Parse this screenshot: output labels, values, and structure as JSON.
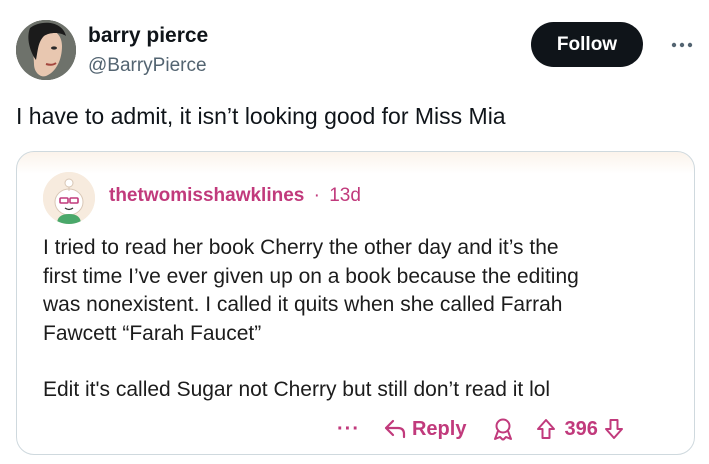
{
  "tweet": {
    "author": {
      "display_name": "barry pierce",
      "handle": "@BarryPierce"
    },
    "follow_label": "Follow",
    "more_icon": "more-horizontal-icon",
    "text": "I have to admit, it isn’t looking good for Miss Mia"
  },
  "quoted_post": {
    "username": "thetwomisshawklines",
    "separator": "·",
    "time_ago": "13d",
    "body_lines": [
      "I tried to read her book Cherry the other day and it’s the",
      "first time I’ve ever given up on a book because the editing",
      "was nonexistent. I called it quits when she called Farrah",
      "Fawcett “Farah Faucet”"
    ],
    "edit_note": "Edit it's called Sugar not Cherry but still don’t read it lol",
    "actions": {
      "more_label": "···",
      "reply_label": "Reply",
      "vote_count": "396"
    },
    "accent_color": "#c13a7c"
  },
  "colors": {
    "follow_bg": "#0f1419",
    "secondary_text": "#536471",
    "border": "#cfd9de"
  }
}
